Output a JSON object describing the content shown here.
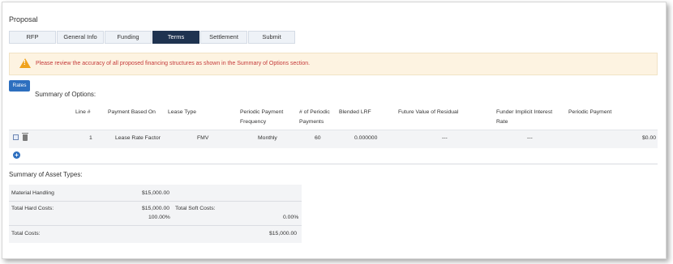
{
  "page": {
    "title": "Proposal"
  },
  "tabs": [
    {
      "label": "RFP",
      "active": false
    },
    {
      "label": "General Info",
      "active": false
    },
    {
      "label": "Funding",
      "active": false
    },
    {
      "label": "Terms",
      "active": true
    },
    {
      "label": "Settlement",
      "active": false
    },
    {
      "label": "Submit",
      "active": false
    }
  ],
  "alert": {
    "icon": "warning-icon",
    "message": "Please review the accuracy of all proposed financing structures as shown in the Summary of Options section.",
    "color": "#c43a3a"
  },
  "options": {
    "rates_label": "Rates",
    "title": "Summary of Options:",
    "headers": {
      "line": "Line #",
      "payment_based_on": "Payment Based On",
      "lease_type": "Lease Type",
      "periodic_payment_frequency_1": "Periodic Payment",
      "periodic_payment_frequency_2": "Frequency",
      "num_periodic_payments_1": "# of Periodic",
      "num_periodic_payments_2": "Payments",
      "blended_lrf": "Blended LRF",
      "future_value": "Future Value of Residual",
      "funder_rate_1": "Funder Implicit Interest",
      "funder_rate_2": "Rate",
      "periodic_payment": "Periodic Payment"
    },
    "row": {
      "line": "1",
      "payment_based_on": "Lease Rate Factor",
      "lease_type": "FMV",
      "frequency": "Monthly",
      "num_payments": "60",
      "blended_lrf": "0.000000",
      "future_value": "---",
      "funder_rate": "---",
      "periodic_payment": "$0.00"
    },
    "add_icon": "plus-circle-icon"
  },
  "assets": {
    "title": "Summary of Asset Types:",
    "material_handling_label": "Material Handling",
    "material_handling_value": "$15,000.00",
    "total_hard_label": "Total Hard Costs:",
    "total_hard_value": "$15,000.00",
    "total_hard_pct": "100.00%",
    "total_soft_label": "Total Soft Costs:",
    "total_soft_pct": "0.00%",
    "total_costs_label": "Total Costs:",
    "total_costs_value": "$15,000.00"
  },
  "colors": {
    "accent": "#2d6fbf",
    "active_tab": "#1f3350",
    "alert_bg": "#fdf3e1"
  }
}
